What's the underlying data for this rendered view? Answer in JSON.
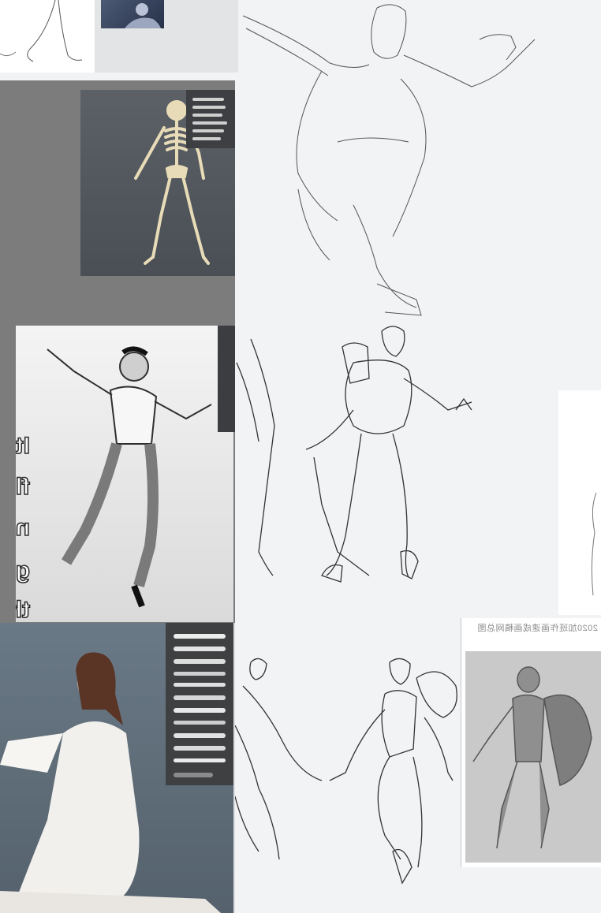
{
  "overlay_text": {
    "lines": [
      "It's very",
      "flow o",
      "no de",
      "genera",
      "there is"
    ]
  },
  "reference_card": {
    "watermark": "2020加班作画速成画稿网总图"
  },
  "colors": {
    "canvas": "#f2f3f5",
    "panel_gray": "#7c7c7c",
    "sketch_line": "#333333"
  },
  "icons": {
    "brush_palette": "brush-palette-icon"
  }
}
